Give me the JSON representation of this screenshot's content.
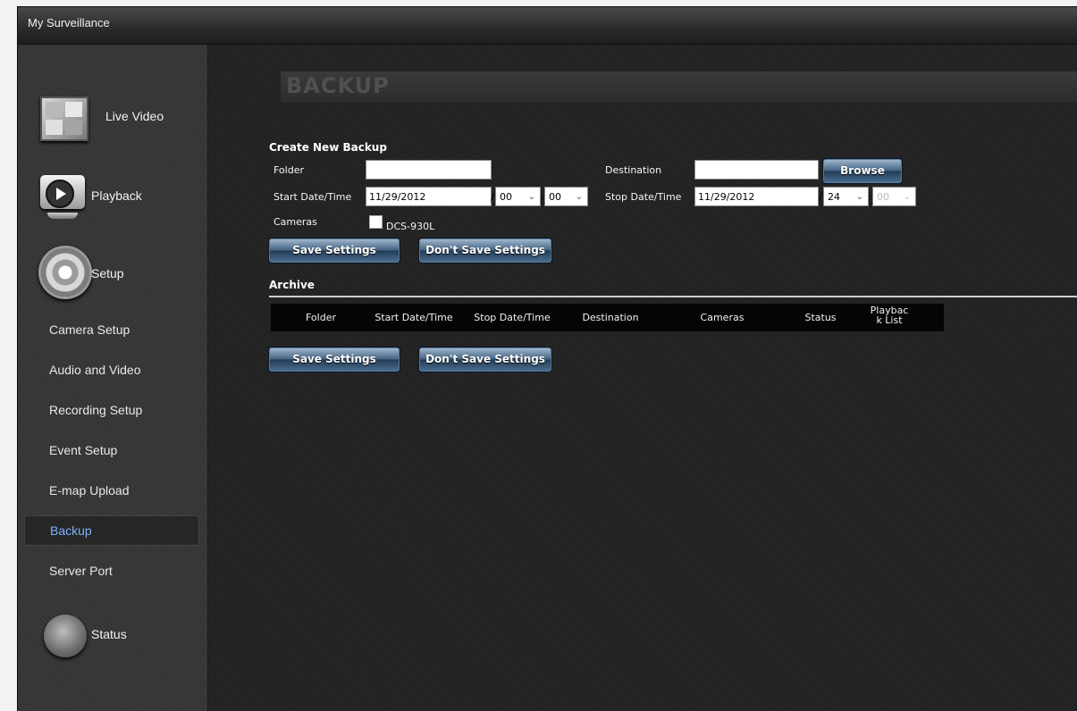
{
  "window": {
    "title": "My Surveillance"
  },
  "sidebar": {
    "live_video": "Live Video",
    "playback": "Playback",
    "setup": "Setup",
    "status": "Status",
    "items": [
      {
        "label": "Camera Setup",
        "active": false
      },
      {
        "label": "Audio and Video",
        "active": false
      },
      {
        "label": "Recording Setup",
        "active": false
      },
      {
        "label": "Event Setup",
        "active": false
      },
      {
        "label": "E-map Upload",
        "active": false
      },
      {
        "label": "Backup",
        "active": true
      },
      {
        "label": "Server Port",
        "active": false
      }
    ]
  },
  "page": {
    "title": "BACKUP"
  },
  "create_backup": {
    "title": "Create New Backup",
    "folder_label": "Folder",
    "folder_value": "",
    "destination_label": "Destination",
    "destination_value": "",
    "browse_label": "Browse",
    "start_label": "Start Date/Time",
    "start_date": "11/29/2012",
    "start_hour": "00",
    "start_min": "00",
    "stop_label": "Stop Date/Time",
    "stop_date": "11/29/2012",
    "stop_hour": "24",
    "stop_min": "00",
    "cameras_label": "Cameras",
    "camera_name": "DCS-930L",
    "camera_checked": false,
    "save_label": "Save Settings",
    "dont_save_label": "Don't Save Settings"
  },
  "archive": {
    "title": "Archive",
    "columns": [
      "Folder",
      "Start Date/Time",
      "Stop Date/Time",
      "Destination",
      "Cameras",
      "Status",
      "Playbac\nk List"
    ],
    "rows": [],
    "save_label": "Save Settings",
    "dont_save_label": "Don't Save Settings"
  },
  "colors": {
    "active_nav": "#7fb0ff",
    "button_blue": "#40607f"
  }
}
